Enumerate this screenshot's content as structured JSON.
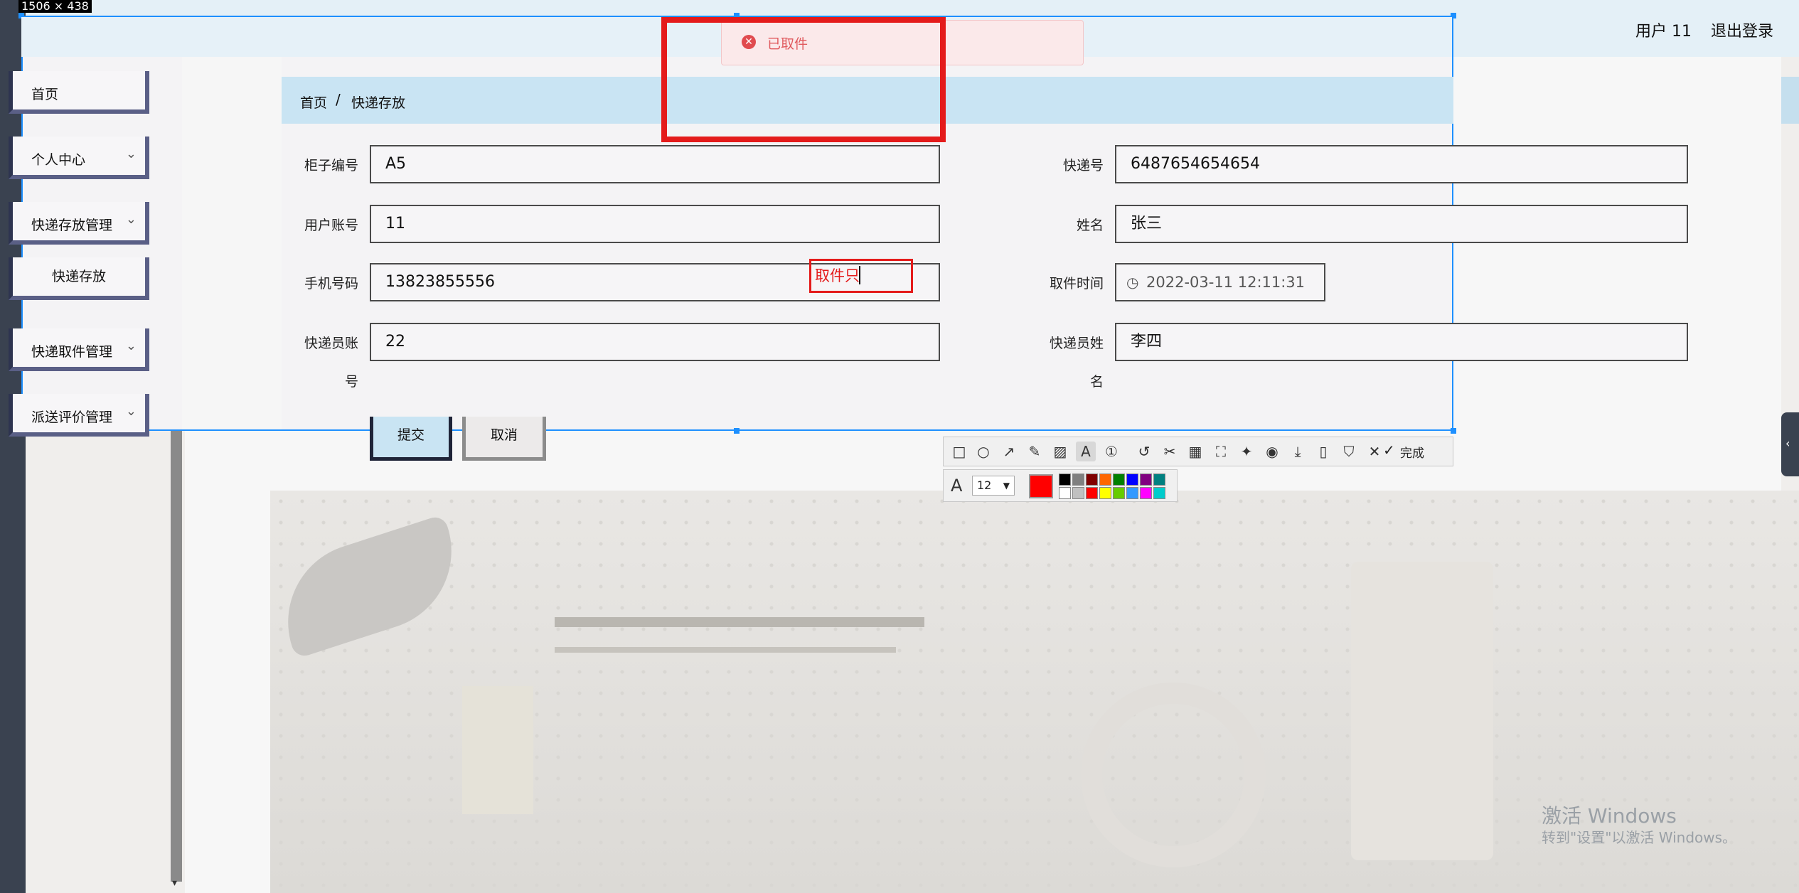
{
  "header": {
    "user": "用户 11",
    "logout": "退出登录"
  },
  "capture": {
    "size_label": "1506 × 438"
  },
  "toast": {
    "text": "已取件"
  },
  "sidebar": {
    "items": [
      {
        "label": "首页"
      },
      {
        "label": "个人中心"
      },
      {
        "label": "快递存放管理"
      },
      {
        "label": "快递存放"
      },
      {
        "label": "快递取件管理"
      },
      {
        "label": "派送评价管理"
      }
    ]
  },
  "breadcrumb": {
    "home": "首页",
    "separator": "/",
    "current": "快递存放"
  },
  "form": {
    "cabinet_label": "柜子编号",
    "cabinet_value": "A5",
    "tracking_label": "快递号",
    "tracking_value": "6487654654654",
    "account_label": "用户账号",
    "account_value": "11",
    "name_label": "姓名",
    "name_value": "张三",
    "phone_label": "手机号码",
    "phone_value": "13823855556",
    "pickup_time_label": "取件时间",
    "pickup_time_value": "2022-03-11 12:11:31",
    "courier_account_label_1": "快递员账",
    "courier_account_label_2": "号",
    "courier_account_value": "22",
    "courier_name_label_1": "快递员姓",
    "courier_name_label_2": "名",
    "courier_name_value": "李四",
    "submit": "提交",
    "cancel": "取消"
  },
  "annotation": {
    "text": "取件只"
  },
  "toolbar": {
    "done": "完成",
    "font_size": "12",
    "current_color": "#ff0000",
    "swatches_row1": [
      "#000000",
      "#808080",
      "#800000",
      "#ff6600",
      "#008000",
      "#0000ff",
      "#800080",
      "#008080"
    ],
    "swatches_row2": [
      "#ffffff",
      "#c0c0c0",
      "#ff0000",
      "#ffff00",
      "#66cc00",
      "#3399ff",
      "#ff00ff",
      "#00cccc"
    ]
  },
  "watermark": {
    "line1": "激活 Windows",
    "line2": "转到\"设置\"以激活 Windows。"
  },
  "colors": {
    "accent": "#c9e4f3",
    "sidebar_border": "#2e3450",
    "annotation": "#e41b1b",
    "selection": "#1e90ff"
  }
}
